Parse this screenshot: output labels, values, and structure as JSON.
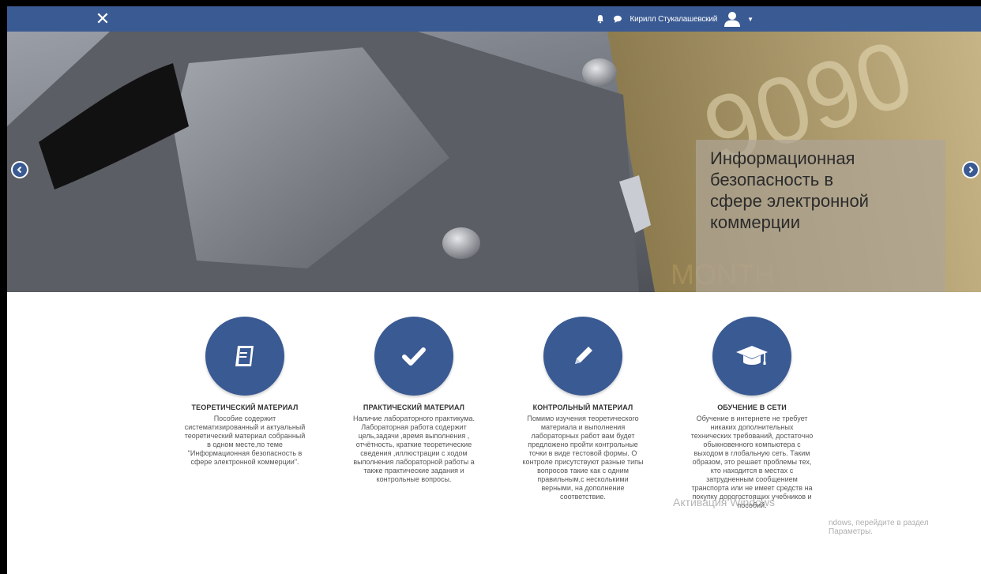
{
  "topbar": {
    "close_symbol": "✕",
    "user_name": "Кирилл Стукалашевский",
    "icons": [
      "bell-icon",
      "chat-icon",
      "user-avatar-icon",
      "caret-down-icon"
    ],
    "color": "#3a5a93"
  },
  "hero": {
    "caption": "Информационная\nбезопасность в\nсфере электронной\nкоммерции",
    "prev_icon": "chevron-left-icon",
    "next_icon": "chevron-right-icon"
  },
  "features": [
    {
      "icon": "book-icon",
      "title": "ТЕОРЕТИЧЕСКИЙ МАТЕРИАЛ",
      "text": "Пособие содержит\nсистематизированный и актуальный\nтеоретический материал собранный\nв одном месте,по теме\n\"Информационная безопасность в\nсфере электронной коммерции\"."
    },
    {
      "icon": "checkmark-icon",
      "title": "ПРАКТИЧЕСКИЙ МАТЕРИАЛ",
      "text": "Наличие лабораторного практикума.\nЛабораторная работа содержит\nцель,задачи ,время выполнения ,\nотчётность, краткие теоретические\nсведения ,иллюстрации с ходом\nвыполнения лабораторной работы а\nтакже практические задания и\nконтрольные вопросы."
    },
    {
      "icon": "pencil-icon",
      "title": "КОНТРОЛЬНЫЙ МАТЕРИАЛ",
      "text": "Помимо изучения теоретического\nматериала и выполнения\nлабораторных работ вам будет\nпредложено пройти контрольные\nточки в виде тестовой формы. О\nконтроле присутствуют разные типы\nвопросов такие как с одним\nправильным,с несколькими\nверными, на дополнение\nсоответствие."
    },
    {
      "icon": "graduation-cap-icon",
      "title": "ОБУЧЕНИЕ В СЕТИ",
      "text": "Обучение в интернете не требует\nникаких дополнительных\nтехнических требований, достаточно\nобыкновенного компьютера с\nвыходом в глобальную сеть. Таким\nобразом, это решает проблемы тех,\nкто находится в местах с\nзатрудненным сообщением\nтранспорта или не имеет средств на\nпокупку дорогостоящих учебников и\nпособий."
    }
  ],
  "watermark": {
    "line1": "Активация Windows",
    "line2": "ndows, перейдите в раздел\nПараметры."
  }
}
